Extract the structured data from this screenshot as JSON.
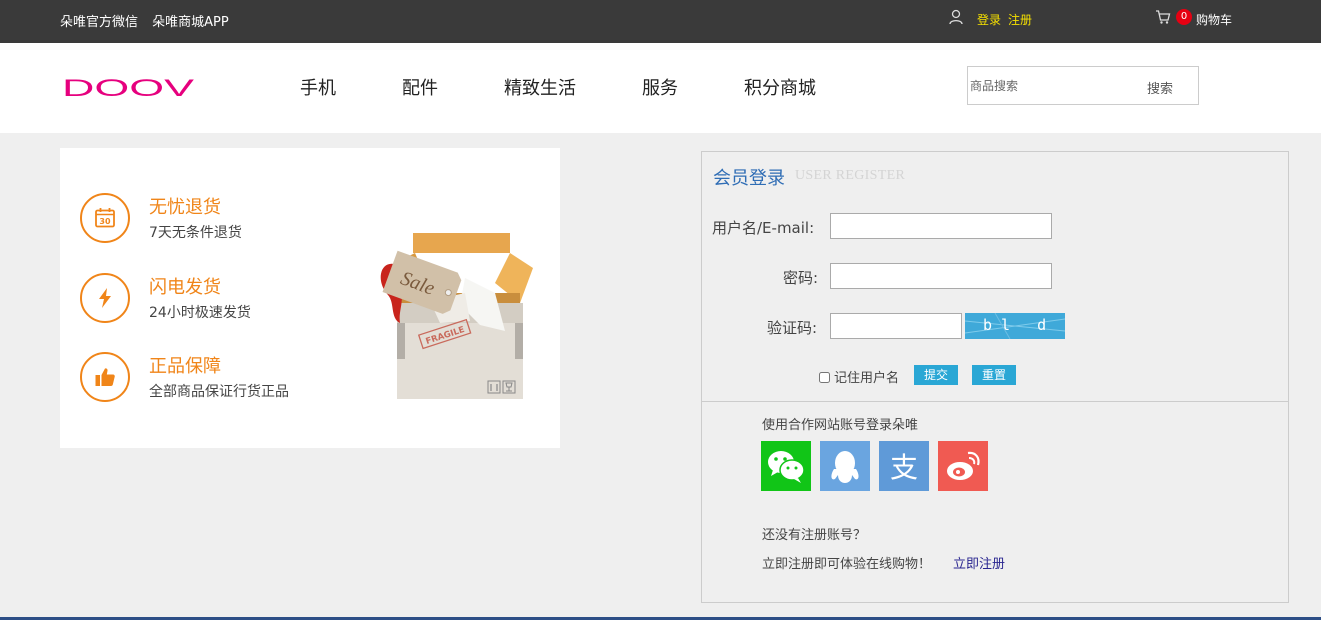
{
  "topbar": {
    "wechat_link": "朵唯官方微信",
    "app_link": "朵唯商城APP",
    "login": "登录",
    "register": "注册",
    "cart_count": "0",
    "cart_label": "购物车"
  },
  "header": {
    "logo_text": "DOOV",
    "nav": [
      {
        "label": "手机"
      },
      {
        "label": "配件"
      },
      {
        "label": "精致生活"
      },
      {
        "label": "服务"
      },
      {
        "label": "积分商城"
      }
    ],
    "search": {
      "placeholder": "商品搜索",
      "button": "搜索"
    }
  },
  "promo": {
    "features": [
      {
        "title": "无忧退货",
        "desc": "7天无条件退货",
        "icon": "calendar-30-icon",
        "icon_text": "30"
      },
      {
        "title": "闪电发货",
        "desc": "24小时极速发货",
        "icon": "lightning-icon"
      },
      {
        "title": "正品保障",
        "desc": "全部商品保证行货正品",
        "icon": "thumbs-up-icon"
      }
    ],
    "illustration": {
      "tag_text": "Sale",
      "stamp_text": "FRAGILE"
    }
  },
  "login": {
    "title": "会员登录",
    "subtitle": "USER REGISTER",
    "username_label": "用户名/E-mail:",
    "password_label": "密码:",
    "captcha_label": "验证码:",
    "captcha_text": "bl d",
    "remember_label": "记住用户名",
    "submit": "提交",
    "reset": "重置",
    "partner_label": "使用合作网站账号登录朵唯",
    "partners": [
      {
        "name": "wechat",
        "color": "#11c517"
      },
      {
        "name": "qq",
        "color": "#6aa5e0"
      },
      {
        "name": "alipay",
        "color": "#5f9ad8"
      },
      {
        "name": "weibo",
        "color": "#f05a52"
      }
    ],
    "no_account": "还没有注册账号？",
    "register_tip": "立即注册即可体验在线购物！",
    "register_link": "立即注册"
  },
  "colors": {
    "accent_orange": "#f08519",
    "logo_pink": "#e6007e",
    "login_title_blue": "#2f6db5",
    "button_blue": "#2aa7d5"
  }
}
